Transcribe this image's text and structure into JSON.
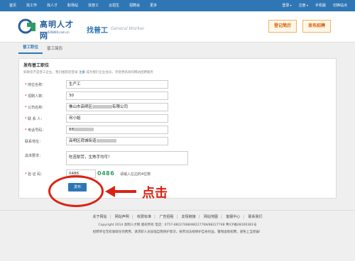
{
  "topbar": {
    "nav": [
      "首页",
      "找工作",
      "找人才",
      "职场站",
      "找普工",
      "云招生",
      "招聘会",
      "更多"
    ],
    "right": [
      "登录",
      "注册",
      "手机版",
      "切换站点"
    ]
  },
  "header": {
    "logo_name": "高明人才网",
    "logo_url": "www.026800.com.cn",
    "section_title": "找普工",
    "section_sub": "General Worker",
    "btn_register": "登记简历",
    "btn_post": "发布招聘"
  },
  "tabs": [
    "普工职位",
    "普工简历"
  ],
  "panel": {
    "title": "发布普工职位",
    "note_prefix": "如果您不是普工企业，我们推荐您登录",
    "note_link": "注册",
    "note_suffix": "成为我们企业会员，享受更高效的网站招聘服务"
  },
  "form": {
    "job_name": {
      "label": "岗位名称：",
      "value": "生产工"
    },
    "count": {
      "label": "招聘人数：",
      "value": "30"
    },
    "company": {
      "label": "公司名称：",
      "value_prefix": "佛山市高明区",
      "value_suffix": "有限公司"
    },
    "contact": {
      "label": "联 系 人：",
      "value": "何小姐"
    },
    "phone": {
      "label": "电话号码：",
      "value": "88"
    },
    "address": {
      "label": "联系地址：",
      "value": "高明区荷城街道"
    },
    "requirement": {
      "label": "具体要求：",
      "value": "吃苦耐劳，生熟手均可！"
    },
    "captcha": {
      "label": "验 证 码：",
      "value": "0486",
      "image_text": "0486",
      "hint": "请输入左边的4位数"
    }
  },
  "submit_label": "发布",
  "annotation_text": "点击",
  "footer": {
    "links": [
      "关于网站",
      "网站声明",
      "收费标准",
      "广告招租",
      "友情链接",
      "网站地图",
      "客服中心",
      "联系我们"
    ],
    "copyright": "Copyright 2014 高明人才网 版权所有 电话：0757-88227488/88227768/88227748 粤ICP备08100381号",
    "warning": "招聘单位无权收取任何费用，请求职人员加强自我保护意识，按劳动法规保护自身权益，警惕虚假招聘，避免上当受骗！"
  },
  "colors": {
    "brand": "#2f76b5",
    "accent": "#d21"
  }
}
